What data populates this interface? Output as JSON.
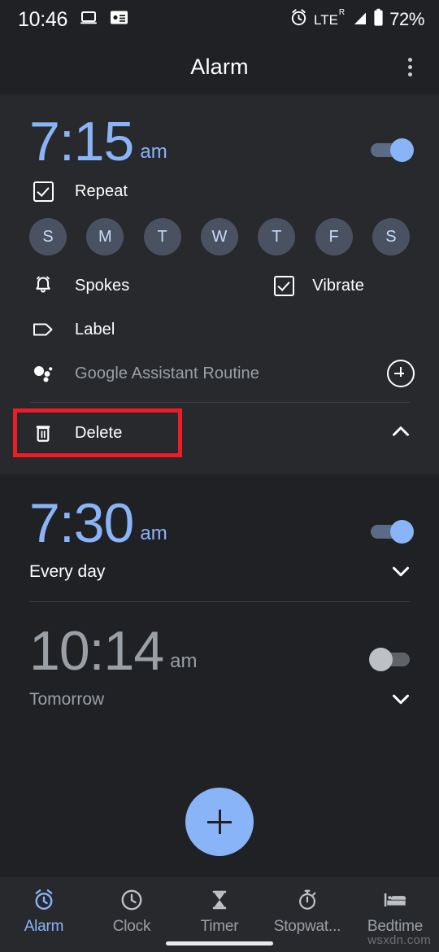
{
  "status_bar": {
    "time": "10:46",
    "icons_left": [
      "laptop-icon",
      "news-card-icon"
    ],
    "icons_right": [
      "alarm-set-icon",
      "signal-icon",
      "battery-icon"
    ],
    "network": "LTE",
    "network_sup": "R",
    "battery": "72%"
  },
  "app_bar": {
    "title": "Alarm",
    "overflow": "overflow-menu-icon"
  },
  "alarms": [
    {
      "time": "7:15",
      "ampm": "am",
      "enabled": true,
      "expanded": true,
      "repeat": {
        "label": "Repeat",
        "checked": true
      },
      "days": [
        {
          "letter": "S",
          "selected": true
        },
        {
          "letter": "M",
          "selected": true
        },
        {
          "letter": "T",
          "selected": true
        },
        {
          "letter": "W",
          "selected": true
        },
        {
          "letter": "T",
          "selected": true
        },
        {
          "letter": "F",
          "selected": true
        },
        {
          "letter": "S",
          "selected": true
        }
      ],
      "ringtone": "Spokes",
      "vibrate": {
        "label": "Vibrate",
        "checked": true
      },
      "label_field": "Label",
      "assistant_routine": "Google Assistant Routine",
      "delete": "Delete"
    },
    {
      "time": "7:30",
      "ampm": "am",
      "enabled": true,
      "expanded": false,
      "schedule": "Every day"
    },
    {
      "time": "10:14",
      "ampm": "am",
      "enabled": false,
      "expanded": false,
      "schedule": "Tomorrow"
    }
  ],
  "fab": {
    "label": "add-alarm",
    "icon": "plus-icon"
  },
  "bottom_nav": [
    {
      "label": "Alarm",
      "icon": "alarm-icon",
      "active": true
    },
    {
      "label": "Clock",
      "icon": "clock-icon",
      "active": false
    },
    {
      "label": "Timer",
      "icon": "hourglass-icon",
      "active": false
    },
    {
      "label": "Stopwat...",
      "icon": "stopwatch-icon",
      "active": false
    },
    {
      "label": "Bedtime",
      "icon": "bed-icon",
      "active": false
    }
  ],
  "watermark": "wsxdn.com",
  "colors": {
    "accent": "#8ab4f8",
    "background": "#202124",
    "surface": "#28292c",
    "muted_text": "#9aa0a6",
    "annotation": "#ee1c25",
    "day_chip": "#4a5160"
  }
}
